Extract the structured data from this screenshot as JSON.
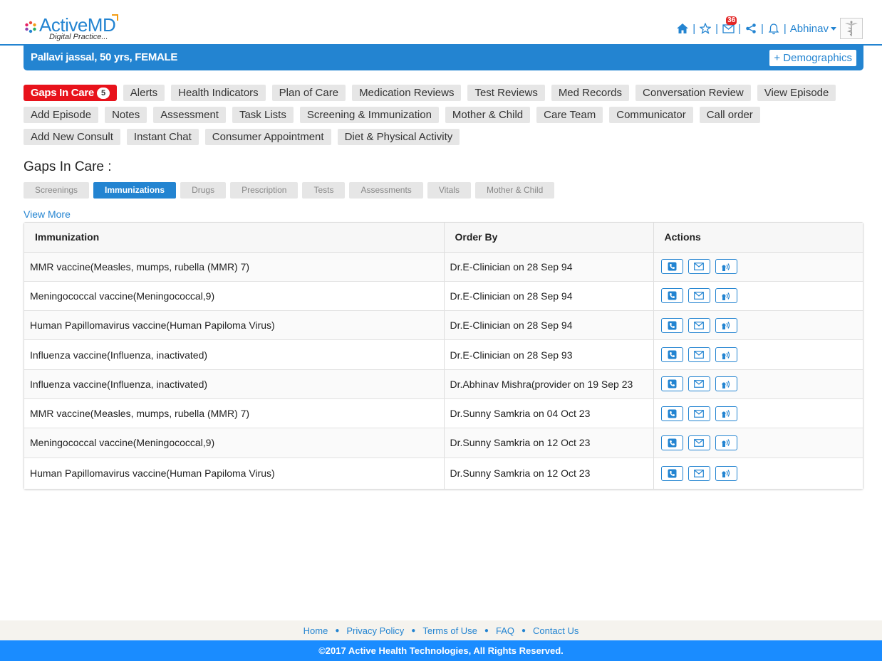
{
  "brand": {
    "logo_text": "ActiveMD",
    "tagline": "Digital Practice...",
    "colors": {
      "primary": "#2384d1",
      "alert": "#e8121b",
      "footer": "#1a8cff"
    }
  },
  "header": {
    "icons": [
      "home-icon",
      "star-icon",
      "mail-icon",
      "share-icon",
      "bell-icon"
    ],
    "mail_count": "36",
    "user_name": "Abhinav"
  },
  "patient": {
    "summary": "Pallavi jassal, 50 yrs, FEMALE",
    "demographics_label": "+ Demographics"
  },
  "nav": {
    "gaps_label": "Gaps In Care",
    "gaps_count": "5",
    "row1": [
      "Alerts",
      "Health Indicators",
      "Plan of Care",
      "Medication Reviews",
      "Test Reviews",
      "Med Records",
      "Conversation Review",
      "View Episode"
    ],
    "row2": [
      "Add Episode",
      "Notes",
      "Assessment",
      "Task Lists",
      "Screening & Immunization",
      "Mother & Child",
      "Care Team",
      "Communicator",
      "Call order"
    ],
    "row3": [
      "Add New Consult",
      "Instant Chat",
      "Consumer Appointment",
      "Diet & Physical Activity"
    ]
  },
  "section": {
    "title": "Gaps In Care :",
    "subtabs": [
      "Screenings",
      "Immunizations",
      "Drugs",
      "Prescription",
      "Tests",
      "Assessments",
      "Vitals",
      "Mother & Child"
    ],
    "active_subtab": "Immunizations",
    "view_more": "View More"
  },
  "table": {
    "headers": [
      "Immunization",
      "Order By",
      "Actions"
    ],
    "rows": [
      [
        "MMR vaccine(Measles, mumps, rubella (MMR) 7)",
        "Dr.E-Clinician on 28 Sep 94"
      ],
      [
        "Meningococcal vaccine(Meningococcal,9)",
        "Dr.E-Clinician on 28 Sep 94"
      ],
      [
        "Human Papillomavirus vaccine(Human Papiloma Virus)",
        "Dr.E-Clinician on 28 Sep 94"
      ],
      [
        "Influenza vaccine(Influenza, inactivated)",
        "Dr.E-Clinician on 28 Sep 93"
      ],
      [
        "Influenza vaccine(Influenza, inactivated)",
        "Dr.Abhinav Mishra(provider on 19 Sep 23"
      ],
      [
        "MMR vaccine(Measles, mumps, rubella (MMR) 7)",
        "Dr.Sunny Samkria on 04 Oct 23"
      ],
      [
        "Meningococcal vaccine(Meningococcal,9)",
        "Dr.Sunny Samkria on 12 Oct 23"
      ],
      [
        "Human Papillomavirus vaccine(Human Papiloma Virus)",
        "Dr.Sunny Samkria on 12 Oct 23"
      ]
    ],
    "action_icons": [
      "phone-icon",
      "mail-icon",
      "voice-call-icon"
    ]
  },
  "footer": {
    "links": [
      "Home",
      "Privacy Policy",
      "Terms of Use",
      "FAQ",
      "Contact Us"
    ],
    "copyright": "©2017 Active Health Technologies, All Rights Reserved."
  }
}
